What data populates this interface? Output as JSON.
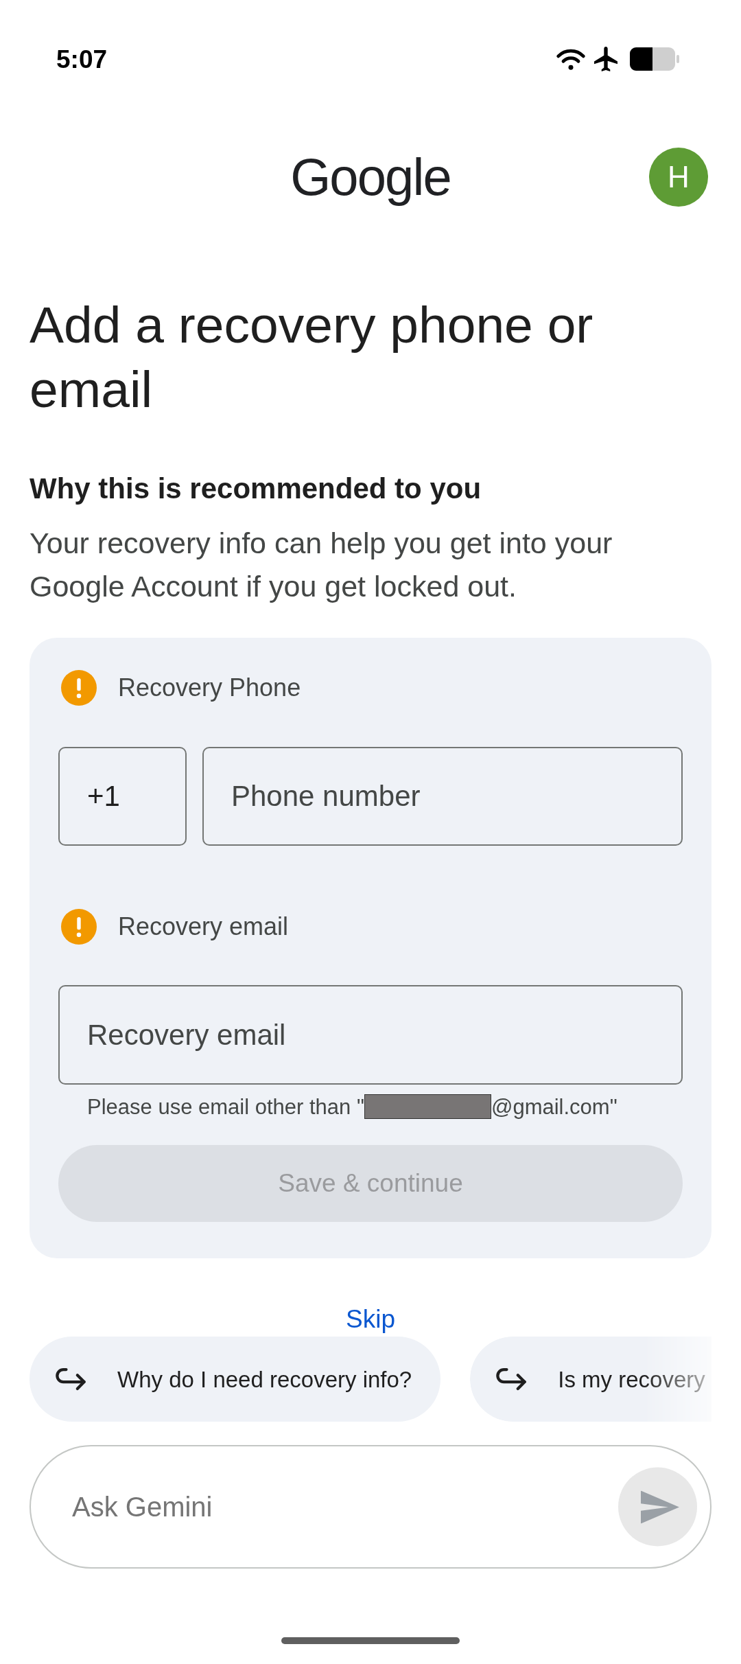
{
  "status_bar": {
    "time": "5:07"
  },
  "header": {
    "logo": "Google",
    "avatar_initial": "H"
  },
  "title": "Add a recovery phone or email",
  "reason": {
    "heading": "Why this is recommended to you",
    "text": "Your recovery info can help you get into your Google Account if you get locked out."
  },
  "recovery_card": {
    "sections": [
      {
        "kind": "phone",
        "label": "Recovery Phone",
        "warning": true,
        "country_code": "+1",
        "placeholder": "Phone number"
      },
      {
        "kind": "email",
        "label": "Recovery email",
        "warning": true,
        "placeholder": "Recovery email",
        "hint": {
          "before": "Please use email other than \"",
          "redacted": true,
          "after": "@gmail.com\""
        }
      }
    ],
    "submit": {
      "label": "Save & continue",
      "disabled": true
    }
  },
  "skip_link": "Skip",
  "suggestions": [
    {
      "label": "Why do I need recovery info?",
      "truncated": false
    },
    {
      "label": "Is my recovery",
      "truncated": true
    }
  ],
  "chat_input": {
    "placeholder": "Ask Gemini"
  }
}
